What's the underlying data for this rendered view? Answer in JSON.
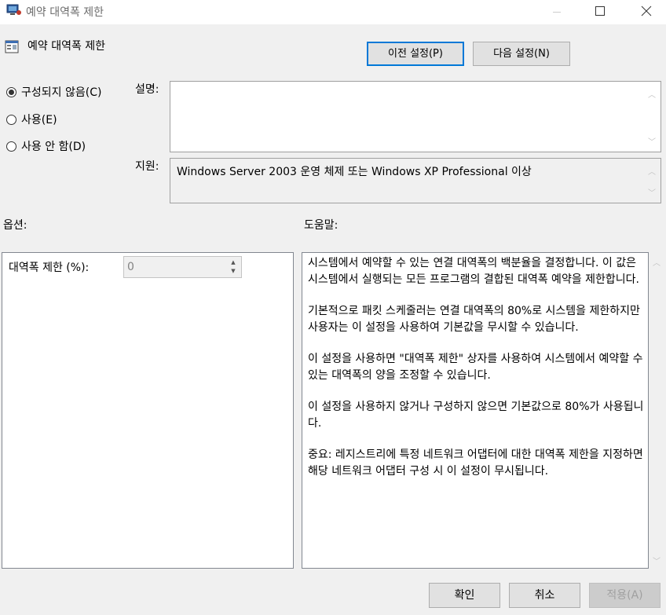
{
  "window": {
    "title": "예약 대역폭 제한"
  },
  "header": {
    "policy_title": "예약 대역폭 제한",
    "prev_button": "이전 설정(P)",
    "next_button": "다음 설정(N)"
  },
  "state": {
    "options": [
      "구성되지 않음(C)",
      "사용(E)",
      "사용 안 함(D)"
    ],
    "selected": "구성되지 않음(C)"
  },
  "comment": {
    "label": "설명:",
    "value": ""
  },
  "support": {
    "label": "지원:",
    "value": "Windows Server 2003 운영 체제 또는 Windows XP Professional 이상"
  },
  "options_section": {
    "label": "옵션:",
    "bandwidth_label": "대역폭 제한 (%):",
    "bandwidth_value": "0"
  },
  "help_section": {
    "label": "도움말:",
    "paragraphs": [
      "시스템에서 예약할 수 있는 연결 대역폭의 백분율을 결정합니다. 이 값은 시스템에서 실행되는 모든 프로그램의 결합된 대역폭 예약을 제한합니다.",
      "기본적으로 패킷 스케줄러는 연결 대역폭의 80%로 시스템을 제한하지만 사용자는 이 설정을 사용하여 기본값을 무시할 수 있습니다.",
      "이 설정을 사용하면 \"대역폭 제한\" 상자를 사용하여 시스템에서 예약할 수 있는 대역폭의 양을 조정할 수 있습니다.",
      "이 설정을 사용하지 않거나 구성하지 않으면 기본값으로 80%가 사용됩니다.",
      "중요: 레지스트리에 특정 네트워크 어댑터에 대한 대역폭 제한을 지정하면 해당 네트워크 어댑터 구성 시 이 설정이 무시됩니다."
    ]
  },
  "footer": {
    "ok": "확인",
    "cancel": "취소",
    "apply": "적용(A)"
  }
}
